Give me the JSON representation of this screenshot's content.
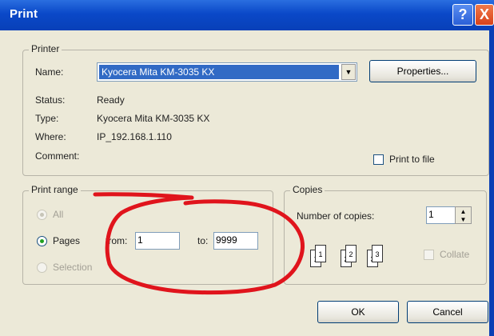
{
  "window": {
    "title": "Print",
    "help_glyph": "?",
    "close_glyph": "X"
  },
  "printer": {
    "legend": "Printer",
    "name_label": "Name:",
    "name_value": "Kyocera Mita KM-3035 KX",
    "properties_label": "Properties...",
    "status_label": "Status:",
    "status_value": "Ready",
    "type_label": "Type:",
    "type_value": "Kyocera Mita KM-3035 KX",
    "where_label": "Where:",
    "where_value": "IP_192.168.1.110",
    "comment_label": "Comment:",
    "print_to_file_label": "Print to file",
    "print_to_file_checked": false
  },
  "print_range": {
    "legend": "Print range",
    "all_label": "All",
    "pages_label": "Pages",
    "selection_label": "Selection",
    "selected": "Pages",
    "from_label": "from:",
    "from_value": "1",
    "to_label": "to:",
    "to_value": "9999"
  },
  "copies": {
    "legend": "Copies",
    "number_label": "Number of copies:",
    "number_value": "1",
    "collate_label": "Collate",
    "collate_checked": false,
    "collate_enabled": false,
    "page_icons": [
      "1",
      "1",
      "2",
      "2",
      "3",
      "3"
    ]
  },
  "buttons": {
    "ok": "OK",
    "cancel": "Cancel"
  },
  "annotation": {
    "color": "#e0141c"
  }
}
